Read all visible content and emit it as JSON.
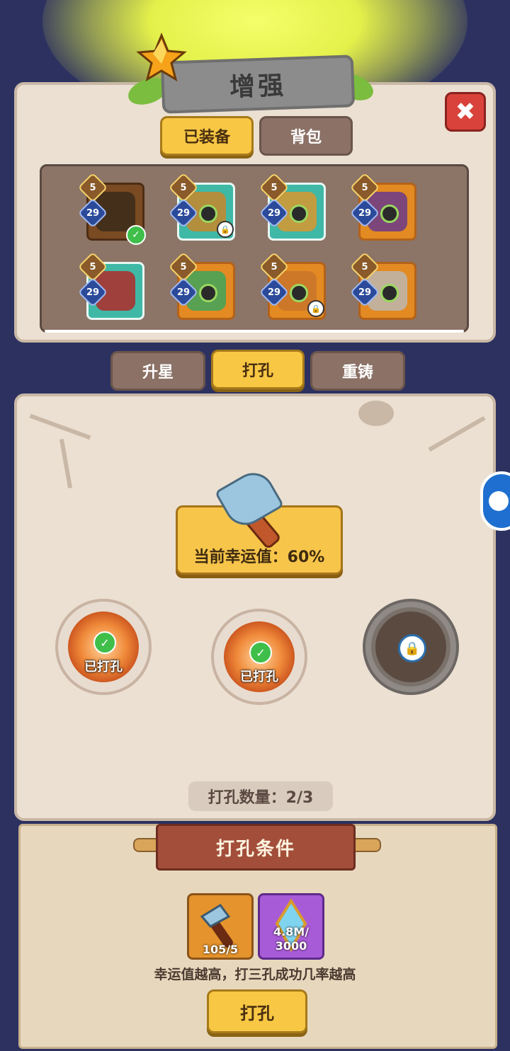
{
  "header": {
    "title": "增强"
  },
  "close_icon": "close-icon",
  "equip_tabs": [
    {
      "label": "已装备",
      "active": true
    },
    {
      "label": "背包",
      "active": false
    }
  ],
  "items": [
    {
      "name": "spiked-flail",
      "stars": "5",
      "level": "29",
      "rarity": "brown",
      "equipped": true,
      "locked": false
    },
    {
      "name": "spartan-helmet",
      "stars": "5",
      "level": "29",
      "rarity": "teal",
      "equipped": false,
      "locked": true
    },
    {
      "name": "golden-armor",
      "stars": "5",
      "level": "29",
      "rarity": "teal",
      "equipped": false,
      "locked": false
    },
    {
      "name": "clawed-gauntlet",
      "stars": "5",
      "level": "29",
      "rarity": "orange",
      "equipped": false,
      "locked": false
    },
    {
      "name": "red-pants",
      "stars": "5",
      "level": "29",
      "rarity": "teal",
      "equipped": false,
      "locked": false
    },
    {
      "name": "winged-boots",
      "stars": "5",
      "level": "29",
      "rarity": "orange",
      "equipped": false,
      "locked": false
    },
    {
      "name": "golden-ring",
      "stars": "5",
      "level": "29",
      "rarity": "orange",
      "equipped": false,
      "locked": true
    },
    {
      "name": "spiked-amulet",
      "stars": "5",
      "level": "29",
      "rarity": "orange",
      "equipped": false,
      "locked": false
    }
  ],
  "mode_tabs": [
    {
      "label": "升星",
      "active": false
    },
    {
      "label": "打孔",
      "active": true
    },
    {
      "label": "重铸",
      "active": false
    }
  ],
  "luck": {
    "text": "当前幸运值：60%",
    "value": 60
  },
  "sockets": [
    {
      "state": "done",
      "label": "已打孔"
    },
    {
      "state": "done",
      "label": "已打孔"
    },
    {
      "state": "locked",
      "label": ""
    }
  ],
  "hole_count": {
    "text": "打孔数量：2/3"
  },
  "conditions": {
    "title": "打孔条件",
    "items": [
      {
        "icon": "hammer-icon",
        "qty": "105/5"
      },
      {
        "icon": "crystal-icon",
        "qty_line1": "4.8M/",
        "qty_line2": "3000"
      }
    ],
    "hint": "幸运值越高，打三孔成功几率越高",
    "button": "打孔"
  },
  "colors": {
    "accent": "#f8c744",
    "panel": "#ece0d2",
    "background": "#2c3160"
  }
}
